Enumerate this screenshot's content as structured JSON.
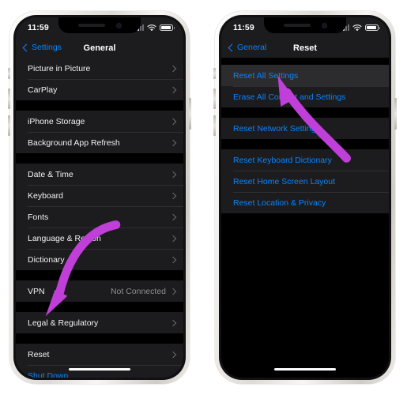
{
  "screens": [
    {
      "id": "general",
      "status": {
        "time": "11:59",
        "signal_icon": "cellular-bars-icon",
        "wifi_icon": "wifi-icon",
        "battery_icon": "battery-icon"
      },
      "nav": {
        "back_label": "Settings",
        "title": "General",
        "back_icon": "chevron-left-icon"
      },
      "groups": [
        {
          "rows": [
            {
              "label": "Picture in Picture",
              "accessory": "chevron-right-icon",
              "style": "normal"
            },
            {
              "label": "CarPlay",
              "accessory": "chevron-right-icon",
              "style": "normal"
            }
          ]
        },
        {
          "rows": [
            {
              "label": "iPhone Storage",
              "accessory": "chevron-right-icon",
              "style": "normal"
            },
            {
              "label": "Background App Refresh",
              "accessory": "chevron-right-icon",
              "style": "normal"
            }
          ]
        },
        {
          "rows": [
            {
              "label": "Date & Time",
              "accessory": "chevron-right-icon",
              "style": "normal"
            },
            {
              "label": "Keyboard",
              "accessory": "chevron-right-icon",
              "style": "normal"
            },
            {
              "label": "Fonts",
              "accessory": "chevron-right-icon",
              "style": "normal"
            },
            {
              "label": "Language & Region",
              "accessory": "chevron-right-icon",
              "style": "normal"
            },
            {
              "label": "Dictionary",
              "accessory": "chevron-right-icon",
              "style": "normal"
            }
          ]
        },
        {
          "rows": [
            {
              "label": "VPN",
              "value": "Not Connected",
              "accessory": "chevron-right-icon",
              "style": "normal"
            }
          ]
        },
        {
          "rows": [
            {
              "label": "Legal & Regulatory",
              "accessory": "chevron-right-icon",
              "style": "normal"
            }
          ]
        },
        {
          "rows": [
            {
              "label": "Reset",
              "accessory": "chevron-right-icon",
              "style": "normal"
            },
            {
              "label": "Shut Down",
              "style": "link"
            }
          ]
        }
      ]
    },
    {
      "id": "reset",
      "status": {
        "time": "11:59",
        "signal_icon": "cellular-bars-icon",
        "wifi_icon": "wifi-icon",
        "battery_icon": "battery-icon"
      },
      "nav": {
        "back_label": "General",
        "title": "Reset",
        "back_icon": "chevron-left-icon"
      },
      "groups": [
        {
          "rows": [
            {
              "label": "Reset All Settings",
              "style": "link",
              "highlight": true
            },
            {
              "label": "Erase All Content and Settings",
              "style": "link"
            }
          ]
        },
        {
          "rows": [
            {
              "label": "Reset Network Settings",
              "style": "link"
            }
          ]
        },
        {
          "rows": [
            {
              "label": "Reset Keyboard Dictionary",
              "style": "link"
            },
            {
              "label": "Reset Home Screen Layout",
              "style": "link"
            },
            {
              "label": "Reset Location & Privacy",
              "style": "link"
            }
          ]
        }
      ]
    }
  ],
  "annotations": {
    "arrow_color": "#c03fd8",
    "left_arrow_target": "Reset",
    "right_arrow_target": "Reset All Settings"
  },
  "colors": {
    "background": "#ffffff",
    "screen_background": "#000000",
    "row_background": "#1c1c1e",
    "link_blue": "#0a84ff",
    "secondary_text": "#8e8e93",
    "accent_arrow": "#c03fd8"
  }
}
